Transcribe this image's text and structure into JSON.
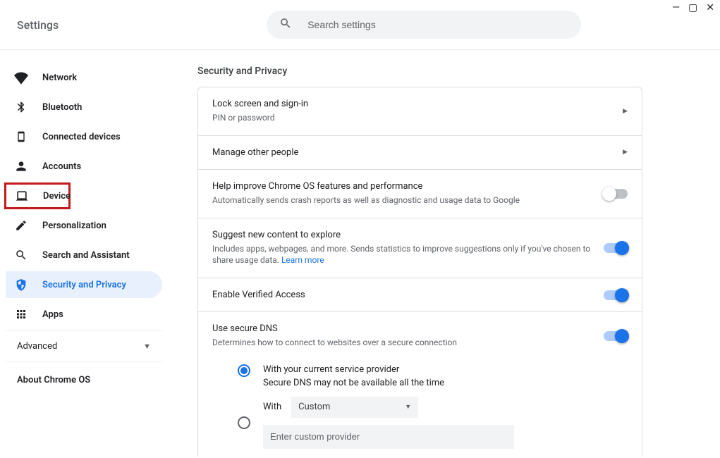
{
  "window": {
    "title": "Settings"
  },
  "search": {
    "placeholder": "Search settings"
  },
  "sidebar": {
    "items": [
      {
        "label": "Network"
      },
      {
        "label": "Bluetooth"
      },
      {
        "label": "Connected devices"
      },
      {
        "label": "Accounts"
      },
      {
        "label": "Device"
      },
      {
        "label": "Personalization"
      },
      {
        "label": "Search and Assistant"
      },
      {
        "label": "Security and Privacy"
      },
      {
        "label": "Apps"
      }
    ],
    "advanced": "Advanced",
    "about": "About Chrome OS"
  },
  "main": {
    "section_title": "Security and Privacy",
    "rows": {
      "lockscreen": {
        "title": "Lock screen and sign-in",
        "sub": "PIN or password"
      },
      "people": {
        "title": "Manage other people"
      },
      "crash": {
        "title": "Help improve Chrome OS features and performance",
        "sub": "Automatically sends crash reports as well as diagnostic and usage data to Google",
        "on": false
      },
      "suggest": {
        "title": "Suggest new content to explore",
        "sub_before": "Includes apps, webpages, and more. Sends statistics to improve suggestions only if you've chosen to share usage data.  ",
        "learn_more": "Learn more",
        "on": true
      },
      "verified": {
        "title": "Enable Verified Access",
        "on": true
      },
      "dns": {
        "title": "Use secure DNS",
        "sub": "Determines how to connect to websites over a secure connection",
        "on": true,
        "opt1_label": "With your current service provider",
        "opt1_sub": "Secure DNS may not be available all the time",
        "opt2_label": "With",
        "select_value": "Custom",
        "custom_placeholder": "Enter custom provider"
      }
    }
  }
}
